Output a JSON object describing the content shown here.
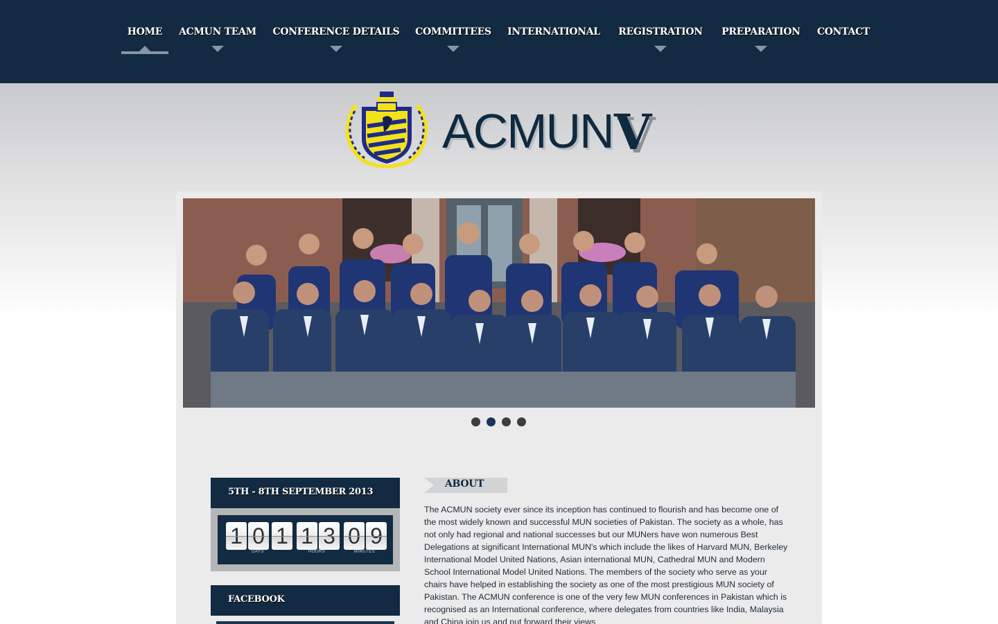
{
  "nav": {
    "items": [
      {
        "label": "HOME",
        "active": true,
        "has_dropdown": false
      },
      {
        "label": "ACMUN TEAM",
        "active": false,
        "has_dropdown": true
      },
      {
        "label": "CONFERENCE DETAILS",
        "active": false,
        "has_dropdown": true
      },
      {
        "label": "COMMITTEES",
        "active": false,
        "has_dropdown": true
      },
      {
        "label": "INTERNATIONAL",
        "active": false,
        "has_dropdown": false
      },
      {
        "label": "REGISTRATION",
        "active": false,
        "has_dropdown": true
      },
      {
        "label": "PREPARATION",
        "active": false,
        "has_dropdown": true
      },
      {
        "label": "CONTACT",
        "active": false,
        "has_dropdown": false
      }
    ]
  },
  "logo": {
    "name": "ACMUN",
    "edition": "V"
  },
  "slider": {
    "slide_count": 4,
    "active_index": 1
  },
  "countdown": {
    "heading": "5TH - 8TH SEPTEMBER 2013",
    "digits": [
      "1",
      "0",
      "1",
      "1",
      "3",
      "0",
      "9"
    ],
    "labels": {
      "days": "DAYS",
      "hours": "HOURS",
      "minutes": "MINUTES"
    }
  },
  "facebook": {
    "heading": "FACEBOOK"
  },
  "about": {
    "title": "ABOUT",
    "text": "The ACMUN society ever since its inception has continued to flourish and has become one of the most widely known and successful MUN societies of Pakistan. The society as a whole, has not only had regional and national successes but our MUNers have won numerous Best Delegations at significant International MUN's which include the likes of Harvard MUN, Berkeley International Model United Nations, Asian international MUN, Cathedral MUN and Modern School International Model United Nations. The members of the society who serve as your chairs have helped in establishing the society as one of the most prestigious MUN society of Pakistan. The ACMUN conference is one of the very few MUN conferences in Pakistan which is recognised as an International conference, where delegates from countries like India, Malaysia and China join us and put forward their views"
  },
  "colors": {
    "navy": "#122a42",
    "crest_yellow": "#f3e21a",
    "crest_blue": "#1f2a8a",
    "panel_gray": "#ebebec"
  }
}
